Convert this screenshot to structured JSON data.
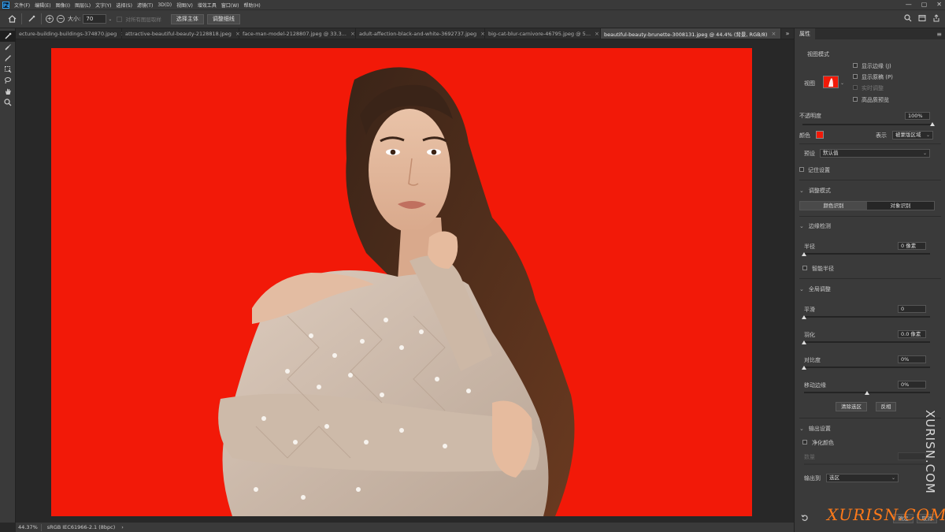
{
  "app": {
    "logo": "Ps"
  },
  "menu": [
    "文件(F)",
    "编辑(E)",
    "图像(I)",
    "图层(L)",
    "文字(Y)",
    "选择(S)",
    "滤镜(T)",
    "3D(D)",
    "视图(V)",
    "增效工具",
    "窗口(W)",
    "帮助(H)"
  ],
  "window_controls": {
    "minimize": "—",
    "maximize": "▢",
    "close": "✕"
  },
  "options": {
    "size_label": "大小:",
    "size_value": "70",
    "sample_all_label": "对所有图层取样",
    "select_subject": "选择主体",
    "refine_hair": "调整细线"
  },
  "tabs": [
    {
      "label": "ecture-building-buildings-374870.jpeg",
      "close": "×",
      "active": false
    },
    {
      "label": "attractive-beautiful-beauty-2128818.jpeg",
      "close": "×",
      "active": false
    },
    {
      "label": "face-man-model-2128807.jpeg @ 33.3...",
      "close": "×",
      "active": false
    },
    {
      "label": "adult-affection-black-and-white-3692737.jpeg",
      "close": "×",
      "active": false
    },
    {
      "label": "big-cat-blur-carnivore-46795.jpeg @ 5...",
      "close": "×",
      "active": false
    },
    {
      "label": "beautiful-beauty-brunette-3008131.jpeg @ 44.4% (背景, RGB/8)",
      "close": "×",
      "active": true
    }
  ],
  "tabs_more": "»",
  "status": {
    "zoom": "44.37%",
    "profile": "sRGB IEC61966-2.1 (8bpc)",
    "arrow": "›"
  },
  "panel": {
    "tab": "属性",
    "menu_icon": "≡",
    "view_mode_header": "视图模式",
    "view_label": "视图",
    "show_edge": "显示边缘 (J)",
    "show_original": "显示原稿 (P)",
    "realtime": "实时调整",
    "hq_preview": "高品质预览",
    "opacity_label": "不透明度",
    "opacity_value": "100%",
    "opacity_level": 1.0,
    "color_label": "颜色",
    "color_value": "#f21908",
    "display_label": "表示",
    "display_value": "被蒙版区域",
    "preset_label": "预设",
    "preset_value": "默认值",
    "remember_label": "记住设置",
    "adjust_mode_header": "调整模式",
    "mode_color": "颜色识别",
    "mode_object": "对象识别",
    "edge_detect_header": "边缘检测",
    "radius_label": "半径",
    "radius_value": "0 像素",
    "radius_level": 0,
    "smart_radius": "智能半径",
    "global_header": "全局调整",
    "smooth_label": "平滑",
    "smooth_value": "0",
    "smooth_level": 0,
    "feather_label": "羽化",
    "feather_value": "0.0 像素",
    "feather_level": 0,
    "contrast_label": "对比度",
    "contrast_value": "0%",
    "contrast_level": 0,
    "shift_label": "移动边缘",
    "shift_value": "0%",
    "shift_level": 0.5,
    "clear_selection": "清除选区",
    "invert": "反相",
    "output_header": "输出设置",
    "decontaminate": "净化颜色",
    "amount_label": "数量",
    "output_to_label": "输出到",
    "output_to_value": "选区",
    "ok": "确定",
    "cancel": "取消"
  },
  "watermark": {
    "vertical": "XURISN.COM",
    "horizontal": "XURISN.COM"
  },
  "colors": {
    "mask": "#f21908",
    "ui_bg": "#3a3a3a",
    "dark": "#282828"
  }
}
